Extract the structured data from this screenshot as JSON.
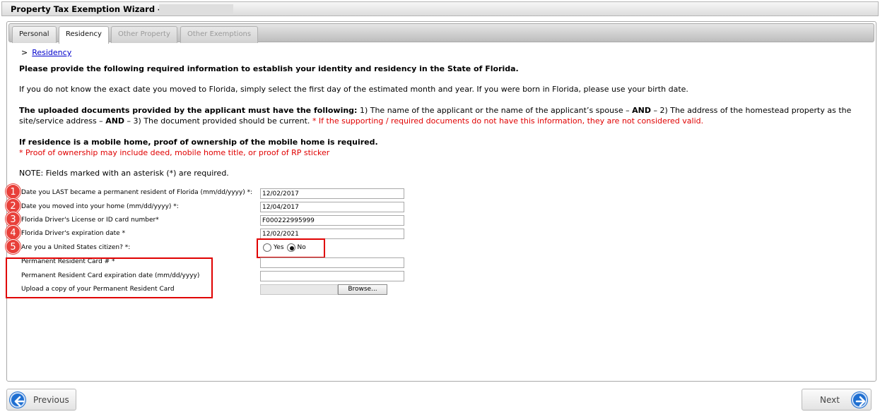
{
  "window": {
    "title": "Property Tax Exemption Wizard -"
  },
  "tabs": [
    {
      "label": "Personal",
      "state": "normal"
    },
    {
      "label": "Residency",
      "state": "active"
    },
    {
      "label": "Other Property",
      "state": "disabled"
    },
    {
      "label": "Other Exemptions",
      "state": "disabled"
    }
  ],
  "breadcrumb": {
    "separator": ">",
    "link": "Residency"
  },
  "intro": {
    "heading": "Please provide the following required information to establish your identity and residency in the State of Florida.",
    "date_hint": "If you do not know the exact date you moved to Florida, simply select the first day of the estimated month and year. If you were born in Florida, please use your birth date.",
    "docs_bold_lead": "The uploaded documents provided by the applicant must have the following:",
    "docs_part1": " 1) The name of the applicant or the name of the applicant’s spouse – ",
    "docs_and1": "AND",
    "docs_part2": " – 2) The address of the homestead property as the",
    "docs_line2_start": "site/service address – ",
    "docs_and2": "AND",
    "docs_part3": " – 3) The document provided should be current. ",
    "docs_warning": "* If the supporting / required documents do not have this information, they are not considered valid.",
    "mobile_heading": "If residence is a mobile home, proof of ownership of the mobile home is required.",
    "mobile_note": "* Proof of ownership may include deed, mobile home title, or proof of RP sticker",
    "required_note": "NOTE: Fields marked with an asterisk (*) are required."
  },
  "fields": {
    "date_became_resident": {
      "badge": "1",
      "label": "Date you LAST became a permanent resident of Florida (mm/dd/yyyy) *:",
      "value": "12/02/2017"
    },
    "date_moved_home": {
      "badge": "2",
      "label": "Date you moved into your home (mm/dd/yyyy) *:",
      "value": "12/04/2017"
    },
    "license_number": {
      "badge": "3",
      "label": "Florida Driver's License or ID card number*",
      "value": "F000222995999"
    },
    "license_expiration": {
      "badge": "4",
      "label": "Florida Driver's expiration date *",
      "value": "12/02/2021"
    },
    "us_citizen": {
      "badge": "5",
      "label": "Are you a United States citizen? *:",
      "yes_label": "Yes",
      "no_label": "No",
      "selected": "No"
    },
    "resident_card_number": {
      "label": "Permanent Resident Card # *",
      "value": ""
    },
    "resident_card_expiration": {
      "label": "Permanent Resident Card expiration date (mm/dd/yyyy)",
      "value": ""
    },
    "resident_card_upload": {
      "label": "Upload a copy of your Permanent Resident Card",
      "button": "Browse..."
    }
  },
  "nav": {
    "previous": "Previous",
    "next": "Next"
  },
  "colors": {
    "badge": "#e8403a",
    "highlight_box": "#e00000",
    "nav_icon": "#1f6fd1",
    "link": "#0000cc"
  }
}
